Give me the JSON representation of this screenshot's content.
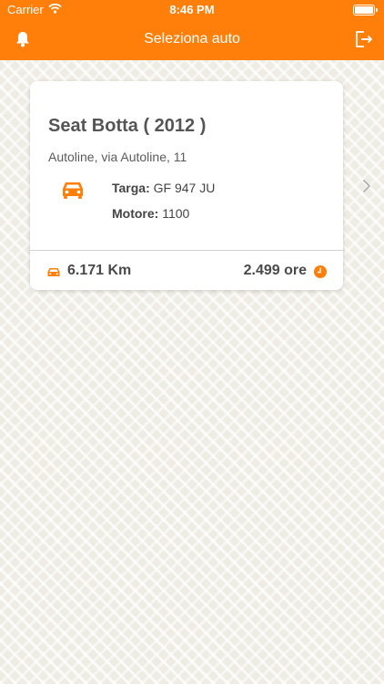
{
  "status_bar": {
    "carrier": "Carrier",
    "time": "8:46 PM",
    "wifi_icon": "wifi-icon",
    "battery_icon": "battery-icon"
  },
  "header": {
    "title": "Seleziona auto",
    "left_icon": "bell-icon",
    "right_icon": "logout-icon",
    "background_color": "#ff7f0a"
  },
  "cars": [
    {
      "title": "Seat Botta ( 2012 )",
      "address": "Autoline, via Autoline, 11",
      "plate_label": "Targa:",
      "plate_value": "GF 947 JU",
      "engine_label": "Motore:",
      "engine_value": "1100",
      "km": "6.171 Km",
      "hours": "2.499 ore",
      "icons": [
        "car-icon",
        "clock-icon",
        "chevron-right-icon"
      ]
    }
  ],
  "colors": {
    "accent": "#ff7f0a",
    "background": "#efece4"
  }
}
